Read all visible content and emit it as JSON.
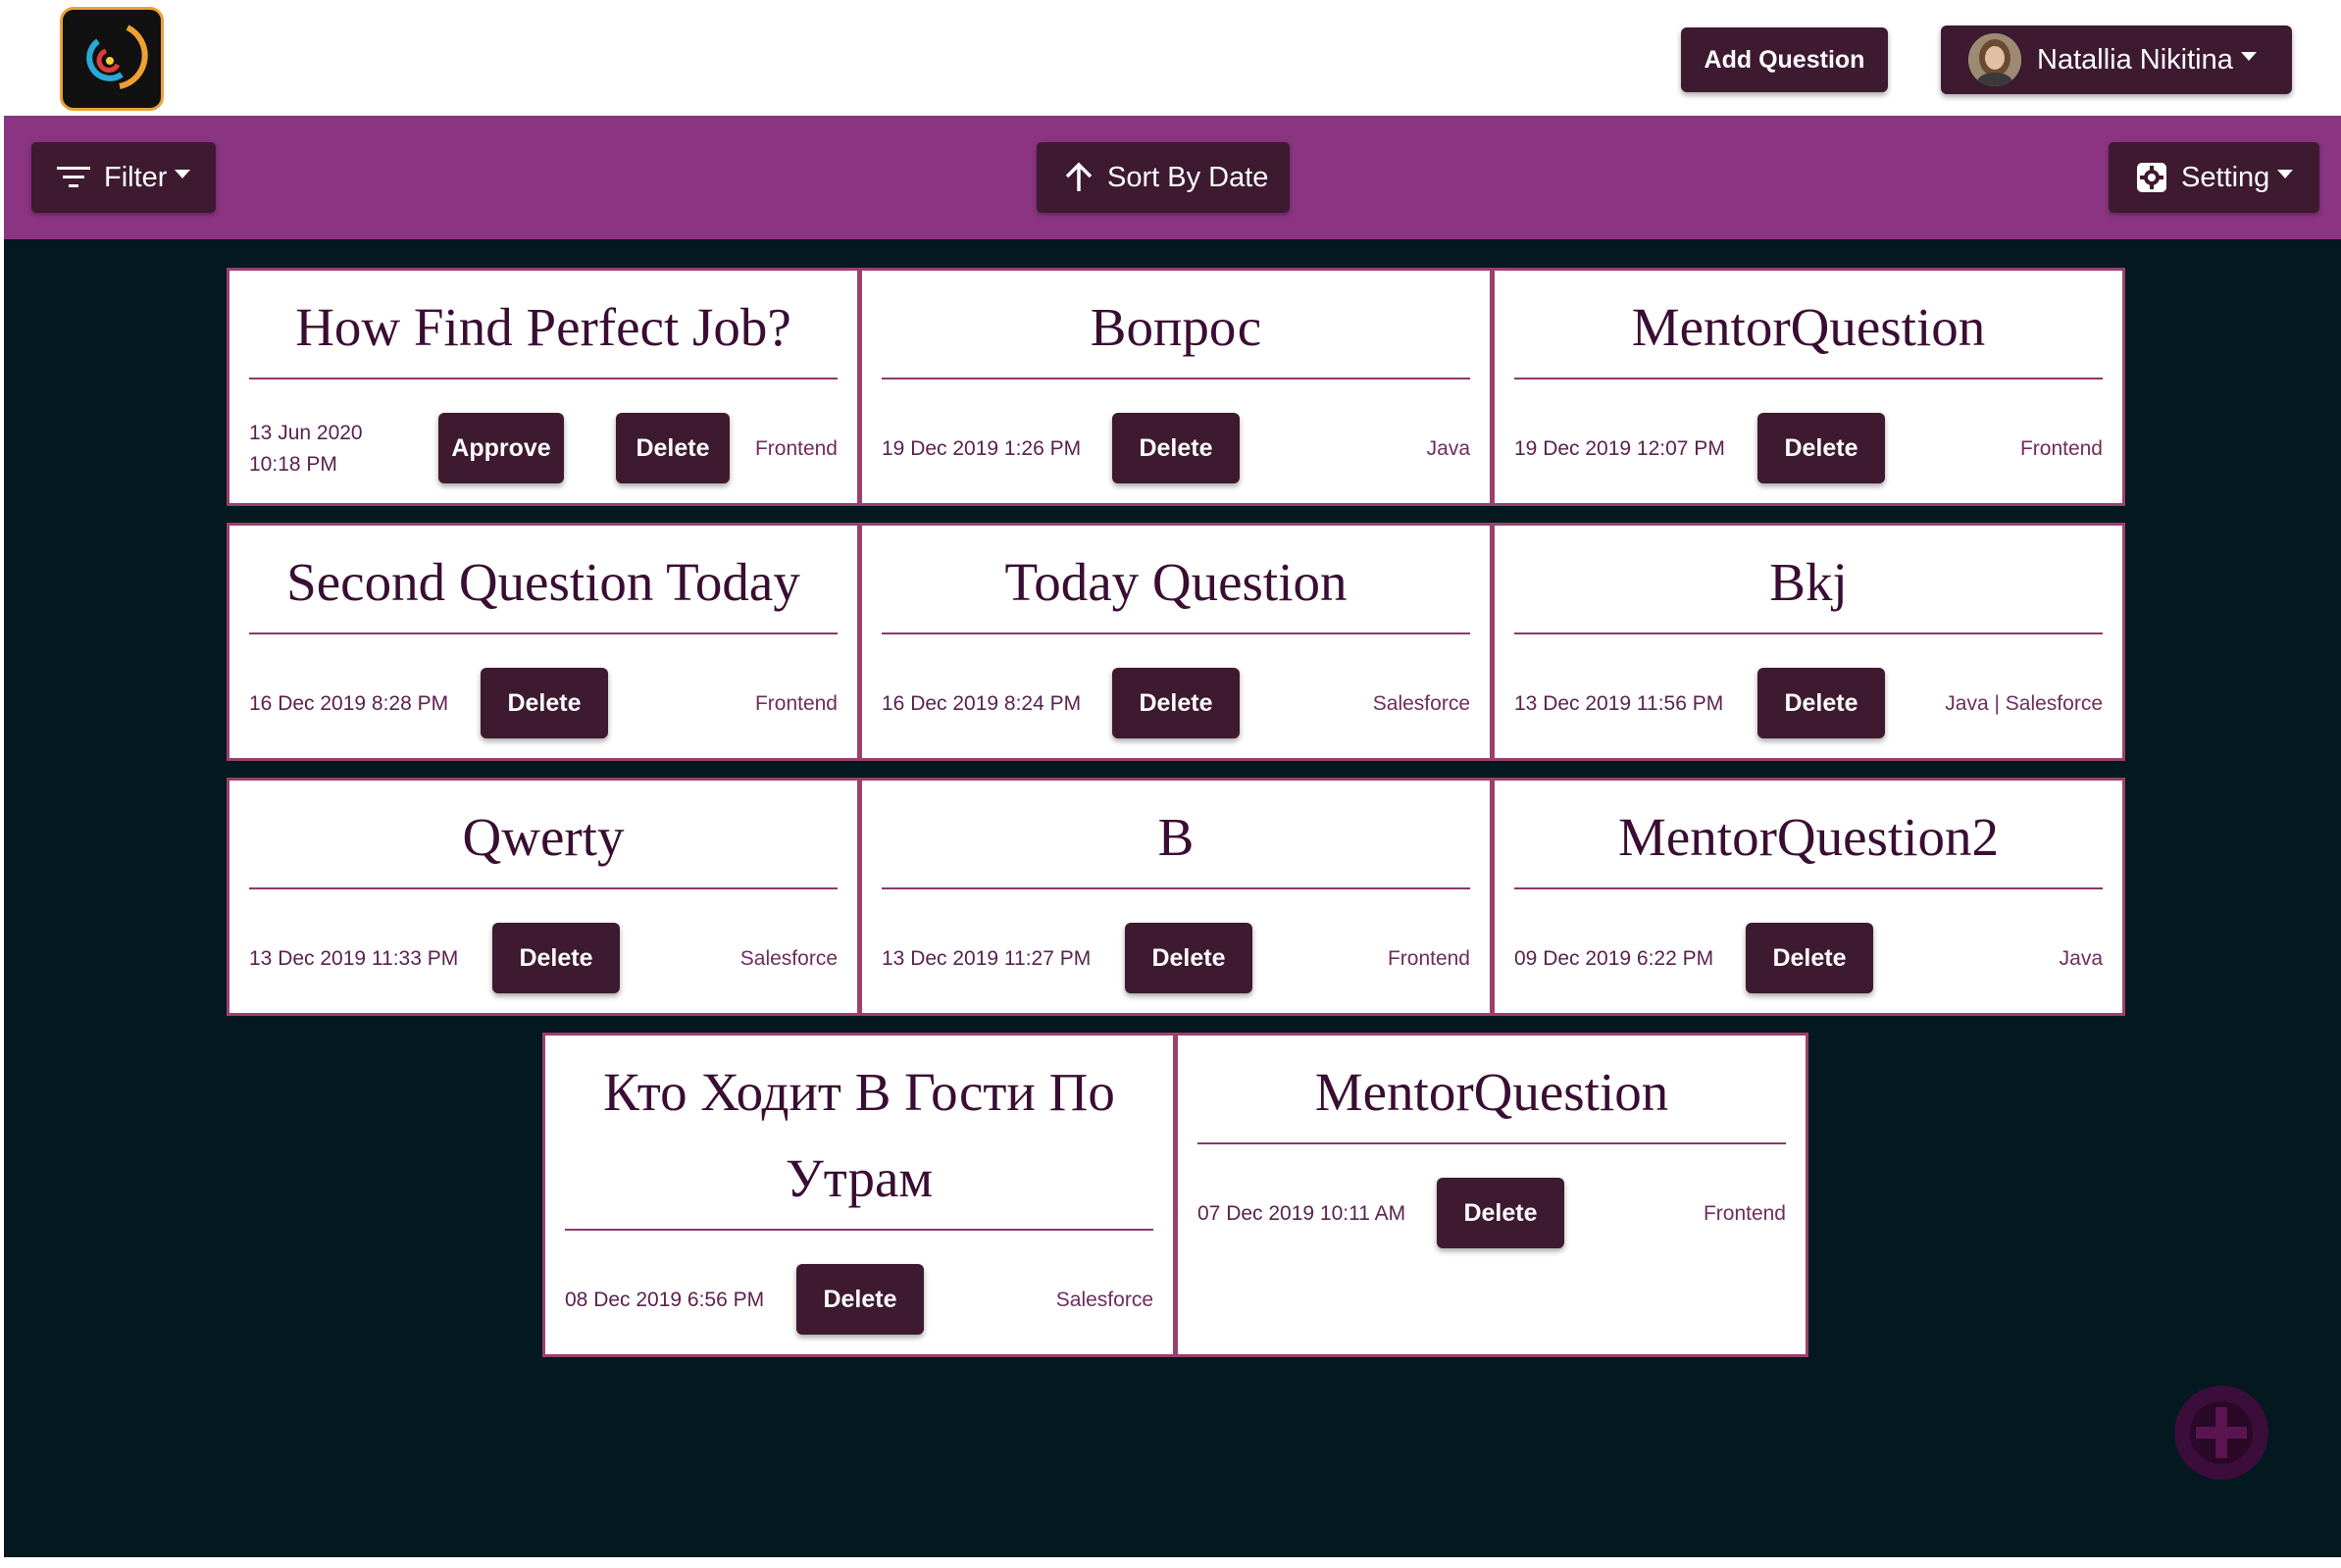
{
  "header": {
    "logo_icon": "app-logo-icon",
    "add_question_label": "Add Question",
    "user_name": "Natallia Nikitina"
  },
  "toolbar": {
    "filter_label": "Filter",
    "sort_label": "Sort By Date",
    "setting_label": "Setting"
  },
  "colors": {
    "header_bg": "#ffffff",
    "toolbar_bg": "#8a3482",
    "page_bg": "#041820",
    "button_bg": "#3d1a30",
    "card_border": "#9c3f6c",
    "title_text": "#3a0d33"
  },
  "cards": [
    {
      "title": "How Find Perfect Job?",
      "date": "13 Jun 2020 10:18 PM",
      "approve_label": "Approve",
      "delete_label": "Delete",
      "tag": "Frontend"
    },
    {
      "title": "Вопрос",
      "date": "19 Dec 2019 1:26 PM",
      "delete_label": "Delete",
      "tag": "Java"
    },
    {
      "title": "MentorQuestion",
      "date": "19 Dec 2019 12:07 PM",
      "delete_label": "Delete",
      "tag": "Frontend"
    },
    {
      "title": "Second Question Today",
      "date": "16 Dec 2019 8:28 PM",
      "delete_label": "Delete",
      "tag": "Frontend"
    },
    {
      "title": "Today Question",
      "date": "16 Dec 2019 8:24 PM",
      "delete_label": "Delete",
      "tag": "Salesforce"
    },
    {
      "title": "Bkj",
      "date": "13 Dec 2019 11:56 PM",
      "delete_label": "Delete",
      "tag": "Java | Salesforce"
    },
    {
      "title": "Qwerty",
      "date": "13 Dec 2019 11:33 PM",
      "delete_label": "Delete",
      "tag": "Salesforce"
    },
    {
      "title": "B",
      "date": "13 Dec 2019 11:27 PM",
      "delete_label": "Delete",
      "tag": "Frontend"
    },
    {
      "title": "MentorQuestion2",
      "date": "09 Dec 2019 6:22 PM",
      "delete_label": "Delete",
      "tag": "Java"
    },
    {
      "title": "Кто Ходит В Гости По Утрам",
      "date": "08 Dec 2019 6:56 PM",
      "delete_label": "Delete",
      "tag": "Salesforce"
    },
    {
      "title": "MentorQuestion",
      "date": "07 Dec 2019 10:11 AM",
      "delete_label": "Delete",
      "tag": "Frontend"
    }
  ],
  "fab_icon": "plus-icon"
}
